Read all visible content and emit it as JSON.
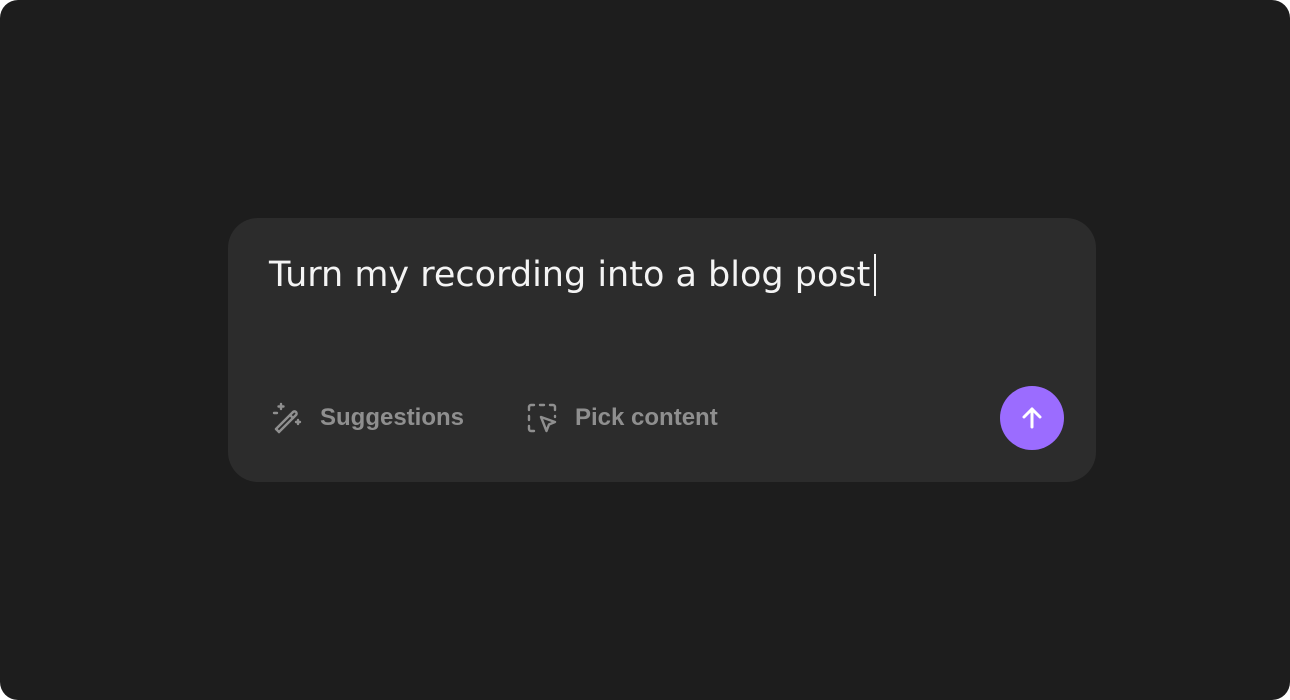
{
  "composer": {
    "prompt_text": "Turn my recording into a blog post",
    "actions": [
      {
        "label": "Suggestions",
        "icon": "magic-wand-icon"
      },
      {
        "label": "Pick content",
        "icon": "select-pointer-icon"
      }
    ],
    "send_icon": "arrow-up-icon"
  },
  "colors": {
    "background": "#1d1d1d",
    "composer_background": "#2c2c2c",
    "prompt_text": "#f4f4f4",
    "muted_label": "#8f8f8f",
    "accent": "#9b6cff"
  }
}
